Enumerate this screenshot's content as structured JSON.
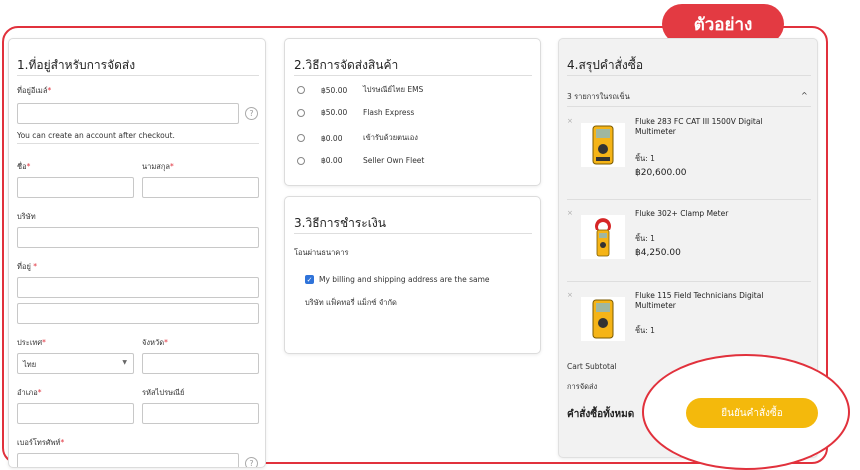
{
  "badge": {
    "label": "ตัวอย่าง"
  },
  "address": {
    "title": "1.ที่อยู่สำหรับการจัดส่ง",
    "email_label": "ที่อยู่อีเมล์",
    "account_note": "You can create an account after checkout.",
    "firstname_label": "ชื่อ",
    "lastname_label": "นามสกุล",
    "company_label": "บริษัท",
    "street_label": "ที่อยู่ ",
    "country_label": "ประเทศ",
    "country_value": "ไทย",
    "province_label": "จังหวัด",
    "district_label": "อำเภอ",
    "postcode_label": "รหัสไปรษณีย์",
    "phone_label": "เบอร์โทรศัพท์",
    "required_mark": "*",
    "help_glyph": "?"
  },
  "shipping": {
    "title": "2.วิธีการจัดส่งสินค้า",
    "options": [
      {
        "price": "฿50.00",
        "name": "ไปรษณีย์ไทย EMS"
      },
      {
        "price": "฿50.00",
        "name": "Flash Express"
      },
      {
        "price": "฿0.00",
        "name": "เข้ารับด้วยตนเอง"
      },
      {
        "price": "฿0.00",
        "name": "Seller Own Fleet"
      }
    ]
  },
  "payment": {
    "title": "3.วิธีการชำระเงิน",
    "method": "โอนผ่านธนาคาร",
    "same_address_label": "My billing and shipping address are the same",
    "company_name": "บริษัท แฟ็คทอรี่ แม็กซ์ จำกัด"
  },
  "summary": {
    "title": "4.สรุปคำสั่งซื้อ",
    "cart_count_label": "3 รายการในรถเข็น",
    "items": [
      {
        "name": "Fluke 283 FC CAT III 1500V Digital Multimeter",
        "qty": "ชิ้น: 1",
        "price": "฿20,600.00"
      },
      {
        "name": "Fluke 302+ Clamp Meter",
        "qty": "ชิ้น: 1",
        "price": "฿4,250.00"
      },
      {
        "name": "Fluke 115 Field Technicians Digital Multimeter",
        "qty": "ชิ้น: 1",
        "price": ""
      }
    ],
    "subtotal_label": "Cart Subtotal",
    "shipping_label": "การจัดส่ง",
    "total_label": "คำสั่งซื้อทั้งหมด"
  },
  "actions": {
    "place_order": "ยืนยันคำสั่งซื้อ"
  },
  "colors": {
    "accent_red": "#e1313c",
    "button_yellow": "#f4b90c",
    "checkbox_blue": "#2f73d9"
  }
}
